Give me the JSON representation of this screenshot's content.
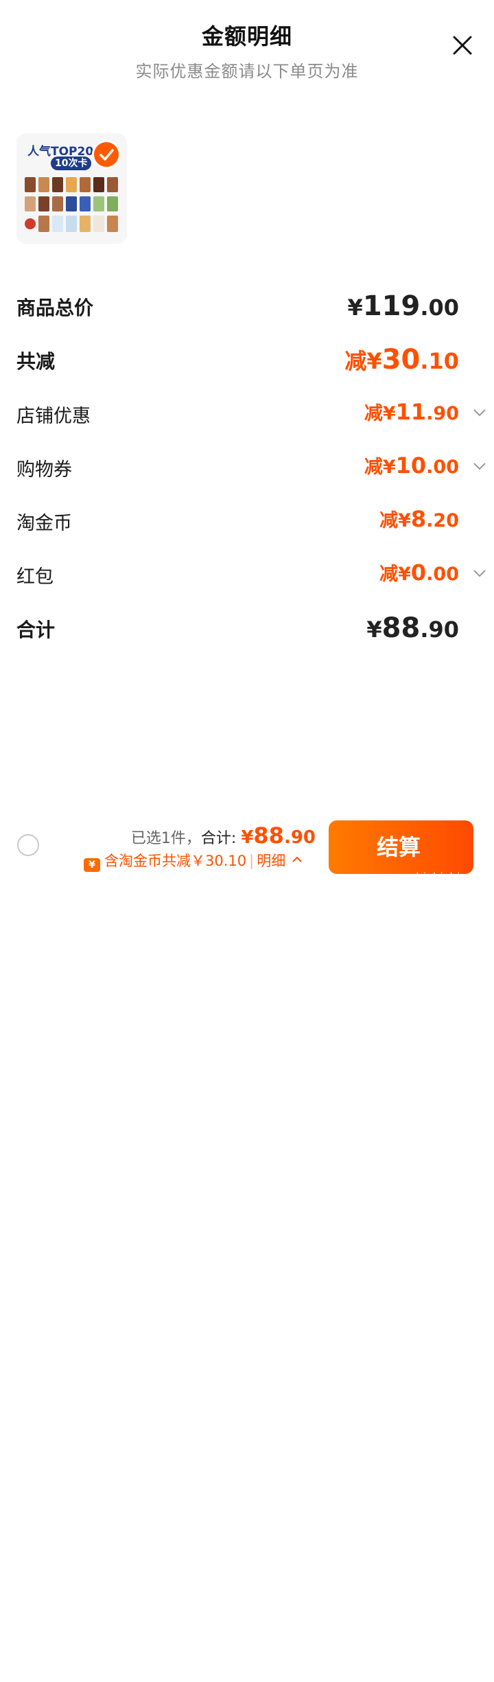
{
  "header": {
    "title": "金额明细",
    "subtitle": "实际优惠金额请以下单页为准"
  },
  "product": {
    "banner_text": "人气TOP20",
    "pill_text": "10次卡",
    "selected": true
  },
  "rows": [
    {
      "label": "商品总价",
      "prefix": "",
      "symbol": "¥",
      "int": "119",
      "dec": ".00",
      "style": "total"
    },
    {
      "label": "共减",
      "prefix": "减",
      "symbol": "¥",
      "int": "30",
      "dec": ".10",
      "style": "discount-total"
    },
    {
      "label": "店铺优惠",
      "prefix": "减",
      "symbol": "¥",
      "int": "11",
      "dec": ".90",
      "style": "discount",
      "expandable": true
    },
    {
      "label": "购物券",
      "prefix": "减",
      "symbol": "¥",
      "int": "10",
      "dec": ".00",
      "style": "discount",
      "expandable": true
    },
    {
      "label": "淘金币",
      "prefix": "减",
      "symbol": "¥",
      "int": "8",
      "dec": ".20",
      "style": "discount",
      "expandable": false
    },
    {
      "label": "红包",
      "prefix": "减",
      "symbol": "¥",
      "int": "0",
      "dec": ".00",
      "style": "discount",
      "expandable": true
    },
    {
      "label": "合计",
      "prefix": "",
      "symbol": "¥",
      "int": "88",
      "dec": ".90",
      "style": "total"
    }
  ],
  "footer": {
    "selected_text": "已选1件，",
    "total_label": "合计:",
    "total_symbol": "¥",
    "total_int": "88",
    "total_dec": ".90",
    "coin_icon_text": "¥",
    "saving_text": "含淘金币共减￥30.10",
    "detail_link": "明细",
    "pay_button": "结算",
    "watermark": "zhizhizhi.com",
    "watermark_logo": "值值值"
  },
  "colors": {
    "accent": "#ff5000",
    "text": "#1a1a1a",
    "muted": "#8a8a8a"
  }
}
